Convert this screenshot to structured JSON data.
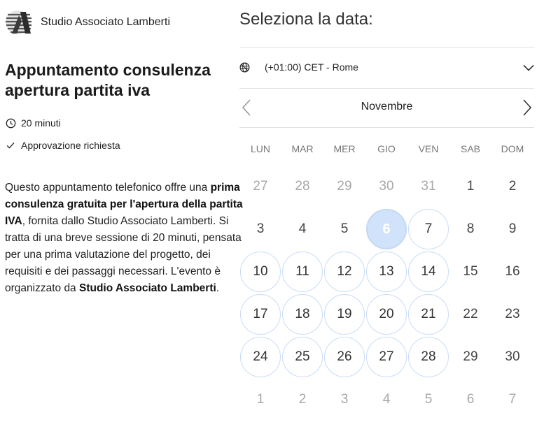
{
  "brand": {
    "name": "Studio Associato Lamberti"
  },
  "event": {
    "title": "Appuntamento consulenza apertura partita iva",
    "duration": "20 minuti",
    "approval": "Approvazione richiesta",
    "description": {
      "p1": "Questo appuntamento telefonico offre una ",
      "b1": "prima consulenza gratuita per l'apertura della partita IVA",
      "p2": ", fornita dallo Studio Associato Lamberti. Si tratta di una breve sessione di 20 minuti, pensata per una prima valutazione del progetto, dei requisiti e dei passaggi necessari. L'evento è organizzato da ",
      "b2": "Studio Associato Lamberti",
      "p3": "."
    }
  },
  "calendar": {
    "heading": "Seleziona la data:",
    "timezone": "(+01:00) CET - Rome",
    "month": "Novembre",
    "weekdays": [
      "LUN",
      "MAR",
      "MER",
      "GIO",
      "VEN",
      "SAB",
      "DOM"
    ],
    "weeks": [
      [
        {
          "d": "27",
          "s": "out"
        },
        {
          "d": "28",
          "s": "out"
        },
        {
          "d": "29",
          "s": "out"
        },
        {
          "d": "30",
          "s": "out"
        },
        {
          "d": "31",
          "s": "out"
        },
        {
          "d": "1",
          "s": "plain"
        },
        {
          "d": "2",
          "s": "plain"
        }
      ],
      [
        {
          "d": "3",
          "s": "plain"
        },
        {
          "d": "4",
          "s": "plain"
        },
        {
          "d": "5",
          "s": "plain"
        },
        {
          "d": "6",
          "s": "selected"
        },
        {
          "d": "7",
          "s": "available"
        },
        {
          "d": "8",
          "s": "plain"
        },
        {
          "d": "9",
          "s": "plain"
        }
      ],
      [
        {
          "d": "10",
          "s": "available"
        },
        {
          "d": "11",
          "s": "available"
        },
        {
          "d": "12",
          "s": "available"
        },
        {
          "d": "13",
          "s": "available"
        },
        {
          "d": "14",
          "s": "available"
        },
        {
          "d": "15",
          "s": "plain"
        },
        {
          "d": "16",
          "s": "plain"
        }
      ],
      [
        {
          "d": "17",
          "s": "available"
        },
        {
          "d": "18",
          "s": "available"
        },
        {
          "d": "19",
          "s": "available"
        },
        {
          "d": "20",
          "s": "available"
        },
        {
          "d": "21",
          "s": "available"
        },
        {
          "d": "22",
          "s": "plain"
        },
        {
          "d": "23",
          "s": "plain"
        }
      ],
      [
        {
          "d": "24",
          "s": "available"
        },
        {
          "d": "25",
          "s": "available"
        },
        {
          "d": "26",
          "s": "available"
        },
        {
          "d": "27",
          "s": "available"
        },
        {
          "d": "28",
          "s": "available"
        },
        {
          "d": "29",
          "s": "plain"
        },
        {
          "d": "30",
          "s": "plain"
        }
      ],
      [
        {
          "d": "1",
          "s": "out"
        },
        {
          "d": "2",
          "s": "out"
        },
        {
          "d": "3",
          "s": "out"
        },
        {
          "d": "4",
          "s": "out"
        },
        {
          "d": "5",
          "s": "out"
        },
        {
          "d": "6",
          "s": "out"
        },
        {
          "d": "7",
          "s": "out"
        }
      ]
    ]
  },
  "icons": {
    "logo": "studio-logo-icon",
    "clock": "clock-icon",
    "check": "check-icon",
    "globe": "globe-icon",
    "chevron_down": "chevron-down-icon",
    "chevron_left": "chevron-left-icon",
    "chevron_right": "chevron-right-icon"
  },
  "colors": {
    "selected_bg": "#d1e3fb",
    "available_border": "#c9dcf5",
    "outside_text": "#a8a8a8",
    "divider": "#e2e2e2"
  }
}
